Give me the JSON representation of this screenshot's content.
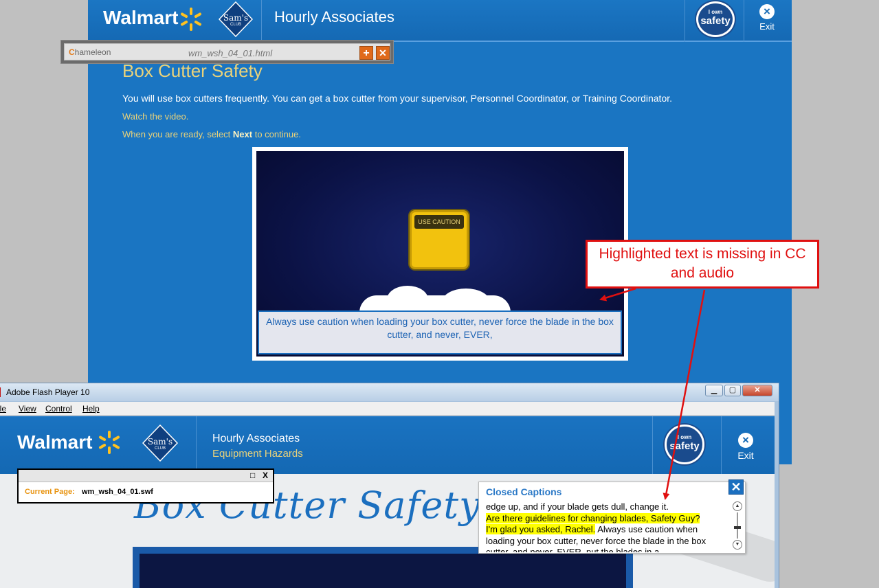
{
  "course": {
    "brand": "Walmart",
    "sams": "Sam's",
    "sams_sub": "CLUB",
    "header_title": "Hourly Associates",
    "badge_line1": "I own",
    "badge_line2": "safety",
    "exit_label": "Exit",
    "page_title": "Box Cutter Safety",
    "intro": "You will use box cutters frequently.  You can get a box cutter from your supervisor, Personnel Coordinator, or Training Coordinator.",
    "watch": "Watch the video.",
    "ready_pre": "When you are ready, select ",
    "ready_next": "Next",
    "ready_post": " to continue.",
    "sign_label": "USE CAUTION",
    "caption": "Always use caution when loading your box cutter, never force the blade in the box cutter, and never, EVER,"
  },
  "chameleon": {
    "logo_c": "C",
    "logo_rest": "hameleon",
    "file": "wm_wsh_04_01.html",
    "plus": "+",
    "close": "✕"
  },
  "flash": {
    "window_title": "Adobe Flash Player 10",
    "minimize": "▁",
    "maximize": "▢",
    "close": "✕",
    "menu": [
      "ile",
      "View",
      "Control",
      "Help"
    ],
    "brand": "Walmart",
    "sams": "Sam's",
    "sams_sub": "CLUB",
    "header_title": "Hourly Associates",
    "header_subtitle": "Equipment Hazards",
    "badge_line1": "I own",
    "badge_line2": "safety",
    "exit_label": "Exit",
    "bg_title": "Box Cutter Safety"
  },
  "current_page": {
    "max": "□",
    "close": "X",
    "label": "Current Page:",
    "value": "wm_wsh_04_01.swf"
  },
  "closed_captions": {
    "title": "Closed Captions",
    "close": "✕",
    "line0": "edge up, and if your blade gets dull, change it.",
    "highlight1": "Are there guidelines for changing blades, Safety Guy?",
    "highlight2": "I'm glad you asked, Rachel.",
    "rest": " Always use caution when loading your box cutter, never force the blade in the box cutter, and never, EVER, put the blades in a",
    "up": "▲",
    "down": "▼"
  },
  "annotation": {
    "text": "Highlighted text is missing in CC and audio"
  },
  "colors": {
    "walmart_blue": "#1a75c2",
    "accent_yellow": "#e9d27a",
    "annotation_red": "#e01010",
    "highlight": "#ffff00"
  }
}
